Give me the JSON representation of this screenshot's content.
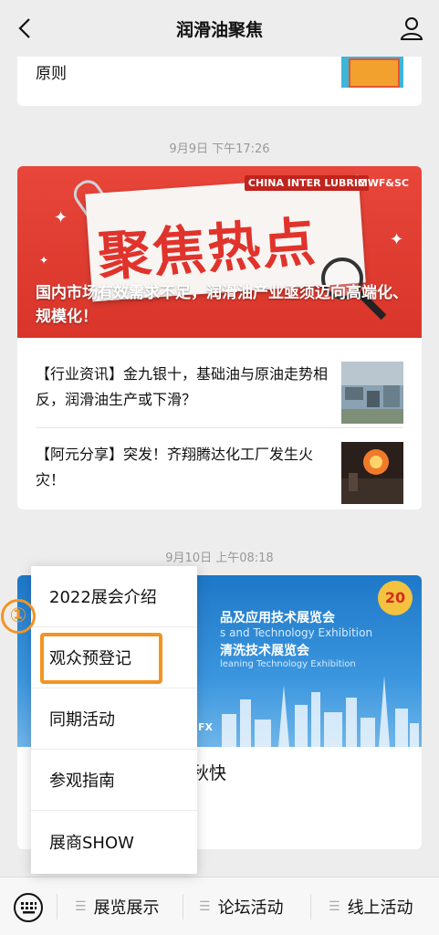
{
  "header": {
    "title": "润滑油聚焦"
  },
  "prev_card": {
    "text": "原则"
  },
  "time1": "9月9日 下午17:26",
  "post1": {
    "banner_big_text": "聚焦热点",
    "banner_logo_left": "CHINA INTER LUBRIC",
    "banner_logo_right": "MWF&SC",
    "caption": "国内市场有效需求不足，润滑油产业亟须迈向高端化、规模化！",
    "items": [
      {
        "text": "【行业资讯】金九银十，基础油与原油走势相反，润滑油生产或下滑？"
      },
      {
        "text": "【阿元分享】突发！齐翔腾达化工厂发生火灾！"
      }
    ]
  },
  "time2": "9月10日 上午08:18",
  "post2": {
    "banner_line1": "品及应用技术展览会",
    "banner_line2": "s and Technology Exhibition",
    "banner_line3": "清洗技术展览会",
    "banner_line4": "leaning Technology Exhibition",
    "badge": "20",
    "sx": "FX",
    "title": "国展润滑油展祝您中秋快"
  },
  "menu": {
    "items": [
      "2022展会介绍",
      "观众预登记",
      "同期活动",
      "参观指南",
      "展商SHOW"
    ]
  },
  "step_marker": "①",
  "bottom_tabs": [
    "展览展示",
    "论坛活动",
    "线上活动"
  ]
}
